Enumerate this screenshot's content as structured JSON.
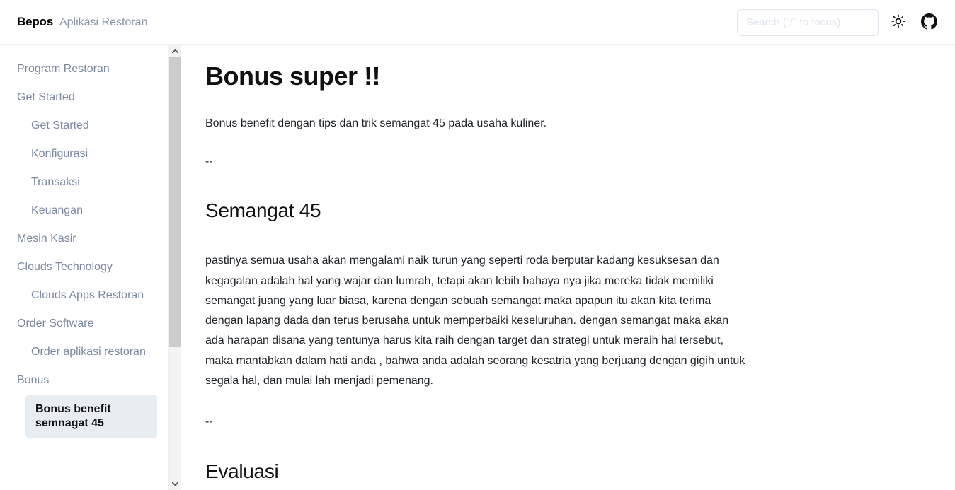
{
  "header": {
    "brand_name": "Bepos",
    "brand_subtitle": "Aplikasi Restoran",
    "search_placeholder": "Search (\"/\" to focus)",
    "search_value": "",
    "theme_toggle_icon": "sun-icon",
    "github_icon": "github-icon",
    "border_color": "#eceff3"
  },
  "sidebar": {
    "link_color": "#7b88a1",
    "active_bg": "#e8edf2",
    "active_text_color": "#121212",
    "items": [
      {
        "label": "Program Restoran",
        "level": 1,
        "active": false
      },
      {
        "label": "Get Started",
        "level": 1,
        "active": false
      },
      {
        "label": "Get Started",
        "level": 2,
        "active": false
      },
      {
        "label": "Konfigurasi",
        "level": 2,
        "active": false
      },
      {
        "label": "Transaksi",
        "level": 2,
        "active": false
      },
      {
        "label": "Keuangan",
        "level": 2,
        "active": false
      },
      {
        "label": "Mesin Kasir",
        "level": 1,
        "active": false
      },
      {
        "label": "Clouds Technology",
        "level": 1,
        "active": false
      },
      {
        "label": "Clouds Apps Restoran",
        "level": 2,
        "active": false
      },
      {
        "label": "Order Software",
        "level": 1,
        "active": false
      },
      {
        "label": "Order aplikasi restoran",
        "level": 2,
        "active": false
      },
      {
        "label": "Bonus",
        "level": 1,
        "active": false
      },
      {
        "label": "Bonus benefit semnagat 45",
        "level": 2,
        "active": true
      }
    ]
  },
  "scrollbar": {
    "up_arrow": "chevron-up-icon",
    "down_arrow": "chevron-down-icon",
    "track_color": "#f3f3f3",
    "thumb_color": "#cccccc"
  },
  "main": {
    "title": "Bonus super !!",
    "intro": "Bonus benefit dengan tips dan trik semangat 45 pada usaha kuliner.",
    "separator_1": "--",
    "section_1_heading": "Semangat 45",
    "section_1_body": "pastinya semua usaha akan mengalami naik turun yang seperti roda berputar kadang kesuksesan dan kegagalan adalah hal yang wajar dan lumrah, tetapi akan lebih bahaya nya jika mereka tidak memiliki semangat juang yang luar biasa, karena dengan sebuah semangat maka apapun itu akan kita terima dengan lapang dada dan terus berusaha untuk memperbaiki keseluruhan. dengan semangat maka akan ada harapan disana yang tentunya harus kita raih dengan target dan strategi untuk meraih hal tersebut, maka mantabkan dalam hati anda , bahwa anda adalah seorang kesatria yang berjuang dengan gigih untuk segala hal, dan mulai lah menjadi pemenang.",
    "separator_2": "--",
    "section_2_heading": "Evaluasi"
  }
}
